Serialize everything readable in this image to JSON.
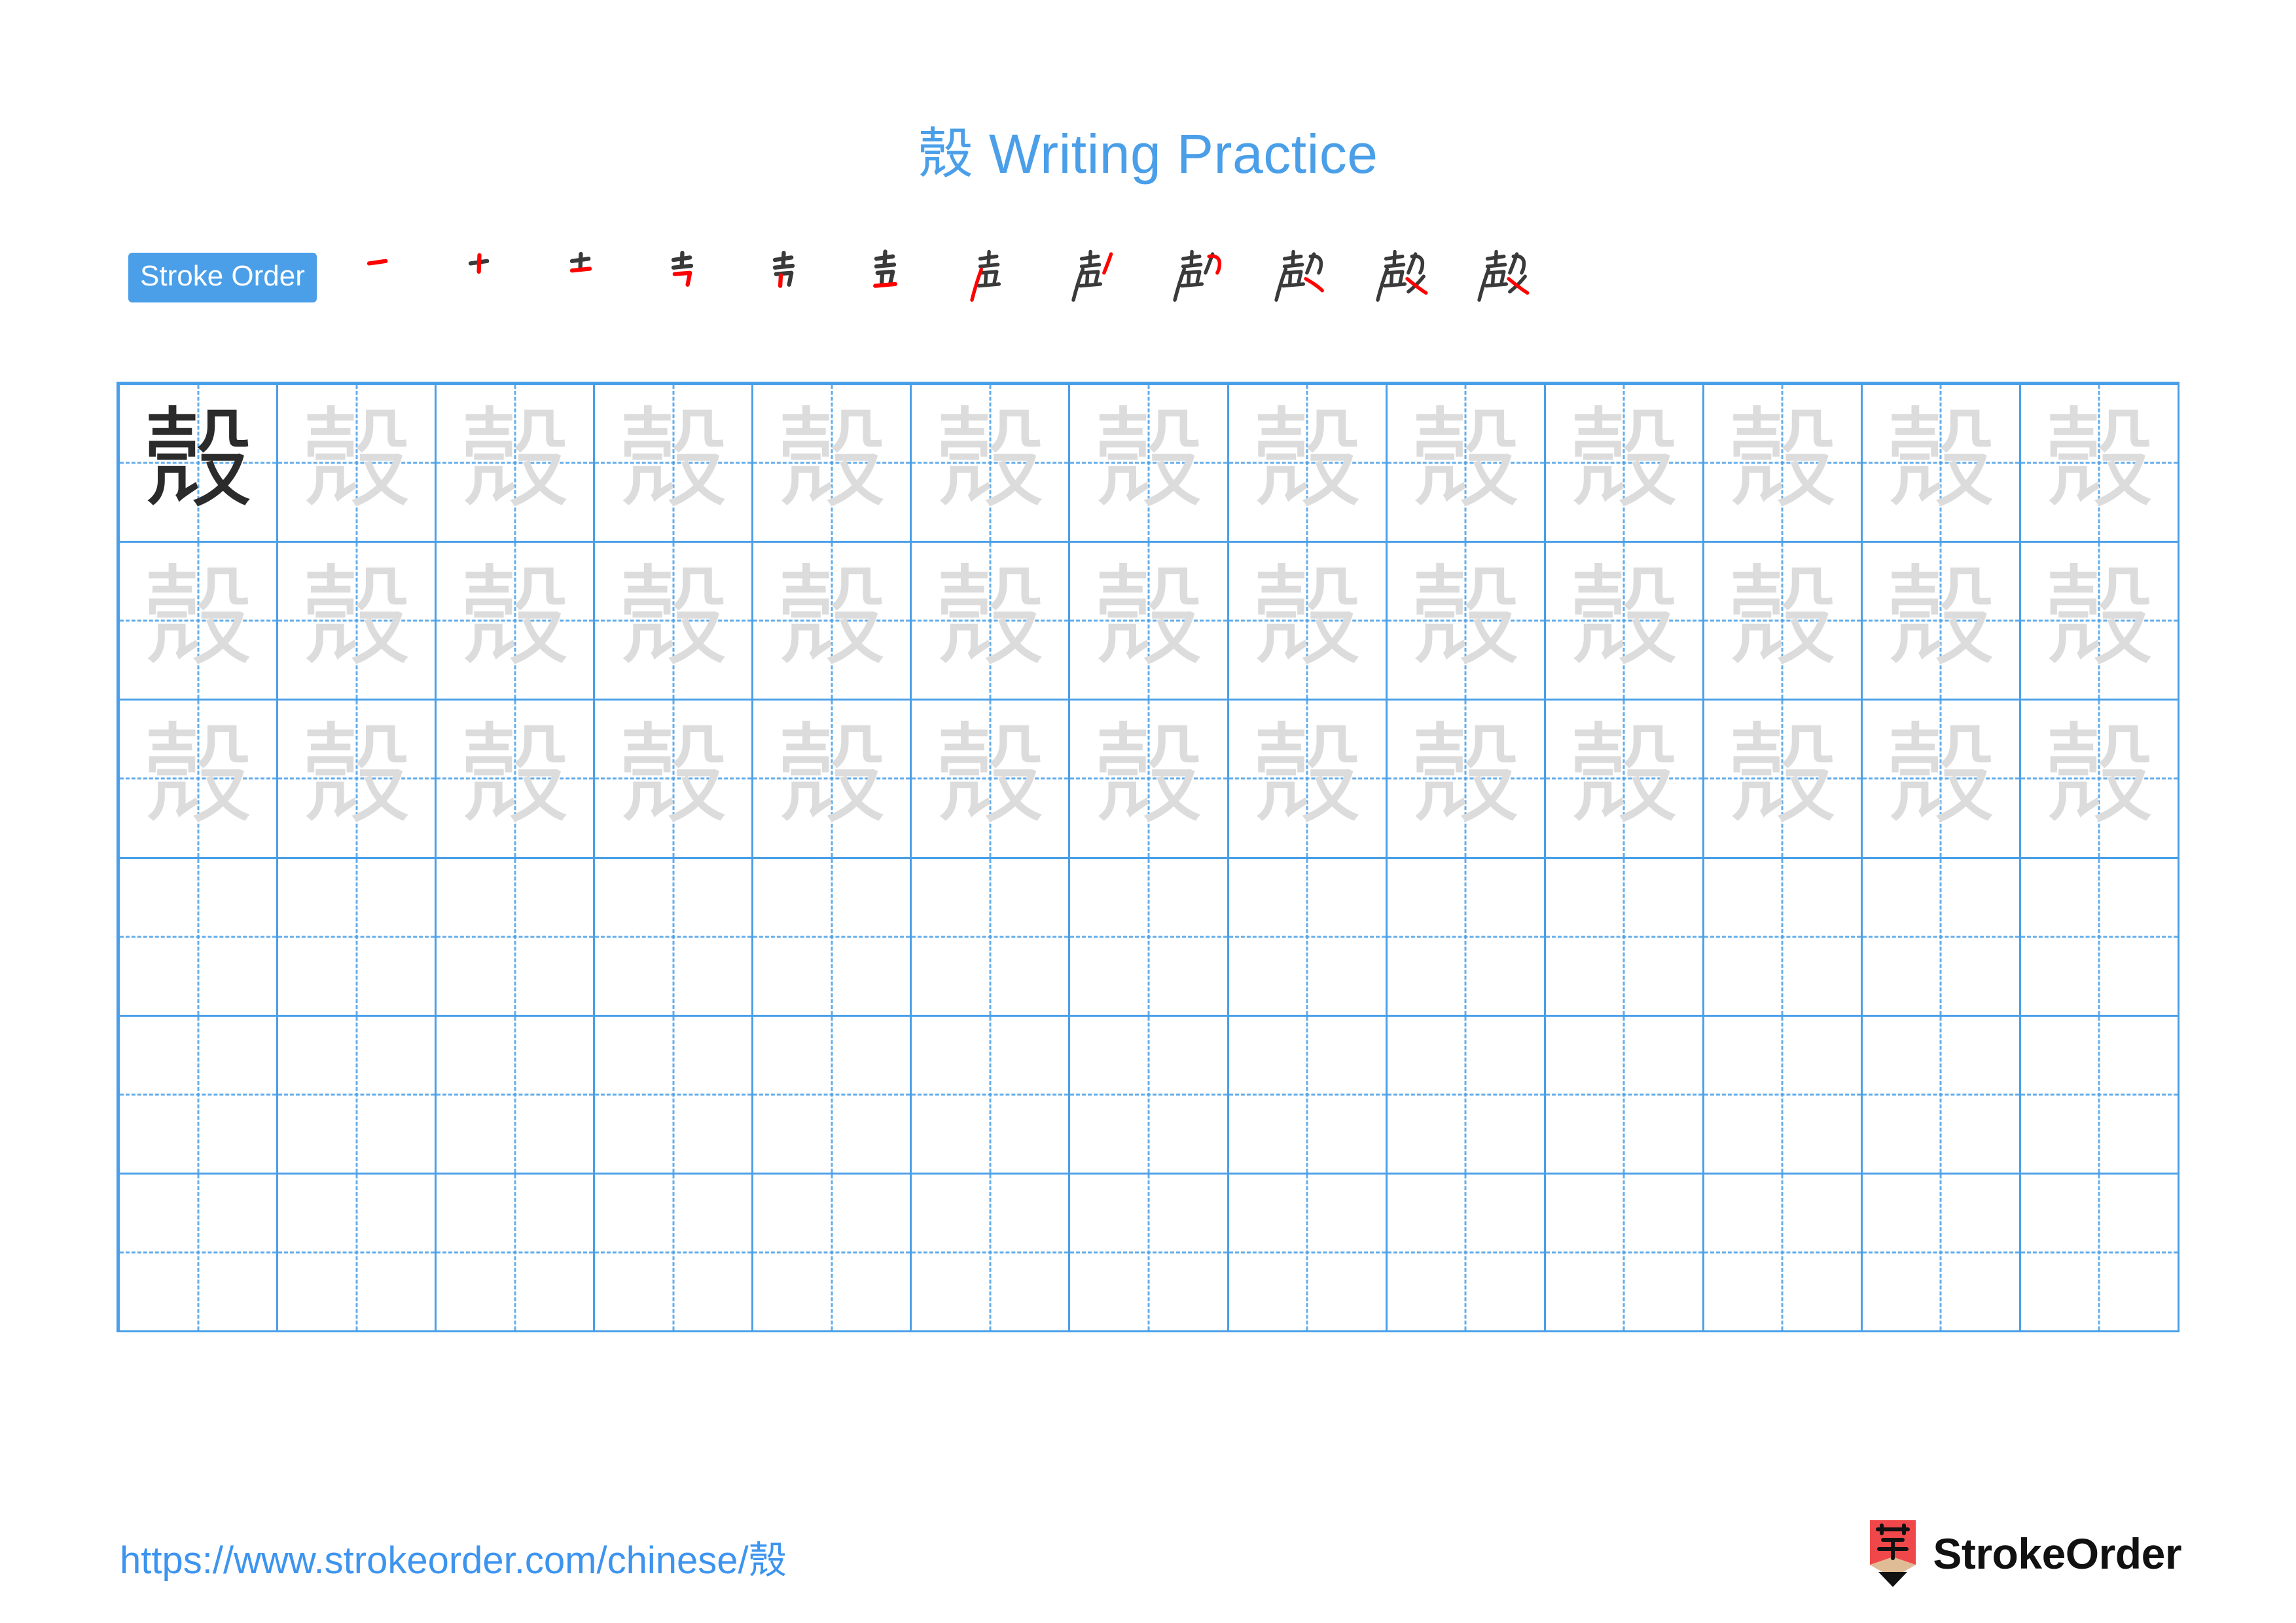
{
  "page": {
    "character": "殼",
    "title": "殼 Writing Practice",
    "accent_color": "#4a9fe8",
    "model_char_color": "#2b2b2b",
    "trace_char_color": "#dcdcdc",
    "stroke_new_color": "#ff0000",
    "stroke_old_color": "#3a3a3a"
  },
  "stroke_order": {
    "label": "Stroke Order",
    "total_strokes": 12,
    "steps": [
      {
        "index": 1,
        "partial": "一"
      },
      {
        "index": 2,
        "partial": "十"
      },
      {
        "index": 3,
        "partial": "士"
      },
      {
        "index": 4,
        "partial": "吉"
      },
      {
        "index": 5,
        "partial": "耂"
      },
      {
        "index": 6,
        "partial": "壴"
      },
      {
        "index": 7,
        "partial": "声"
      },
      {
        "index": 8,
        "partial": "声丿"
      },
      {
        "index": 9,
        "partial": "声几"
      },
      {
        "index": 10,
        "partial": "殻"
      },
      {
        "index": 11,
        "partial": "殼"
      },
      {
        "index": 12,
        "partial": "殼"
      }
    ]
  },
  "grid": {
    "columns": 13,
    "rows": 6,
    "cells": [
      [
        "model",
        "trace",
        "trace",
        "trace",
        "trace",
        "trace",
        "trace",
        "trace",
        "trace",
        "trace",
        "trace",
        "trace",
        "trace"
      ],
      [
        "trace",
        "trace",
        "trace",
        "trace",
        "trace",
        "trace",
        "trace",
        "trace",
        "trace",
        "trace",
        "trace",
        "trace",
        "trace"
      ],
      [
        "trace",
        "trace",
        "trace",
        "trace",
        "trace",
        "trace",
        "trace",
        "trace",
        "trace",
        "trace",
        "trace",
        "trace",
        "trace"
      ],
      [
        "blank",
        "blank",
        "blank",
        "blank",
        "blank",
        "blank",
        "blank",
        "blank",
        "blank",
        "blank",
        "blank",
        "blank",
        "blank"
      ],
      [
        "blank",
        "blank",
        "blank",
        "blank",
        "blank",
        "blank",
        "blank",
        "blank",
        "blank",
        "blank",
        "blank",
        "blank",
        "blank"
      ],
      [
        "blank",
        "blank",
        "blank",
        "blank",
        "blank",
        "blank",
        "blank",
        "blank",
        "blank",
        "blank",
        "blank",
        "blank",
        "blank"
      ]
    ]
  },
  "footer": {
    "url": "https://www.strokeorder.com/chinese/殼",
    "brand_name": "StrokeOrder",
    "brand_mark_char": "字",
    "brand_mark_color": "#f0484a",
    "brand_mark_wood_color": "#e0bc96",
    "brand_mark_tip_color": "#111111"
  }
}
